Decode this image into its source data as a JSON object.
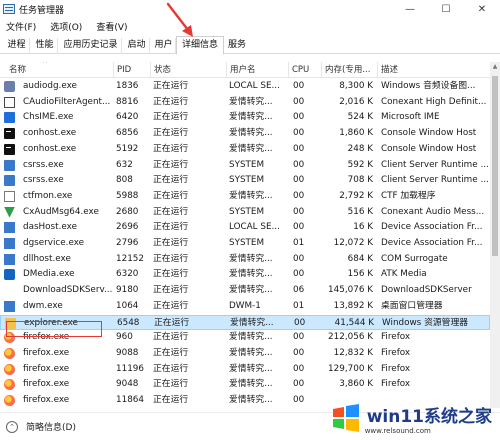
{
  "window": {
    "title": "任务管理器",
    "minimize": "—",
    "maximize": "☐",
    "close": "✕"
  },
  "menu": [
    "文件(F)",
    "选项(O)",
    "查看(V)"
  ],
  "tabs": [
    {
      "label": "进程",
      "active": false
    },
    {
      "label": "性能",
      "active": false
    },
    {
      "label": "应用历史记录",
      "active": false
    },
    {
      "label": "启动",
      "active": false
    },
    {
      "label": "用户",
      "active": false
    },
    {
      "label": "详细信息",
      "active": true
    },
    {
      "label": "服务",
      "active": false
    }
  ],
  "table": {
    "columns": [
      "名称",
      "PID",
      "状态",
      "用户名",
      "CPU",
      "内存(专用...",
      "描述"
    ],
    "sort_indicator": "^",
    "rows": [
      {
        "icon": "gear-icon",
        "name": "audiodg.exe",
        "pid": "1836",
        "status": "正在运行",
        "user": "LOCAL SE...",
        "cpu": "00",
        "mem": "8,300 K",
        "desc": "Windows 音频设备图..."
      },
      {
        "icon": "audio-icon",
        "name": "CAudioFilterAgent...",
        "pid": "8816",
        "status": "正在运行",
        "user": "爱情转究...",
        "cpu": "00",
        "mem": "2,016 K",
        "desc": "Conexant High Definit..."
      },
      {
        "icon": "ime-icon",
        "name": "ChsIME.exe",
        "pid": "6420",
        "status": "正在运行",
        "user": "爱情转究...",
        "cpu": "00",
        "mem": "524 K",
        "desc": "Microsoft IME"
      },
      {
        "icon": "console-icon",
        "name": "conhost.exe",
        "pid": "6856",
        "status": "正在运行",
        "user": "爱情转究...",
        "cpu": "00",
        "mem": "1,860 K",
        "desc": "Console Window Host"
      },
      {
        "icon": "console-icon",
        "name": "conhost.exe",
        "pid": "5192",
        "status": "正在运行",
        "user": "爱情转究...",
        "cpu": "00",
        "mem": "248 K",
        "desc": "Console Window Host"
      },
      {
        "icon": "system-icon",
        "name": "csrss.exe",
        "pid": "632",
        "status": "正在运行",
        "user": "SYSTEM",
        "cpu": "00",
        "mem": "592 K",
        "desc": "Client Server Runtime ..."
      },
      {
        "icon": "system-icon",
        "name": "csrss.exe",
        "pid": "808",
        "status": "正在运行",
        "user": "SYSTEM",
        "cpu": "00",
        "mem": "708 K",
        "desc": "Client Server Runtime ..."
      },
      {
        "icon": "ctf-icon",
        "name": "ctfmon.exe",
        "pid": "5988",
        "status": "正在运行",
        "user": "爱情转究...",
        "cpu": "00",
        "mem": "2,792 K",
        "desc": "CTF 加载程序"
      },
      {
        "icon": "cx-icon",
        "name": "CxAudMsg64.exe",
        "pid": "2680",
        "status": "正在运行",
        "user": "SYSTEM",
        "cpu": "00",
        "mem": "516 K",
        "desc": "Conexant Audio Mess..."
      },
      {
        "icon": "window-icon",
        "name": "dasHost.exe",
        "pid": "2696",
        "status": "正在运行",
        "user": "LOCAL SE...",
        "cpu": "00",
        "mem": "16 K",
        "desc": "Device Association Fr..."
      },
      {
        "icon": "window-icon",
        "name": "dgservice.exe",
        "pid": "2796",
        "status": "正在运行",
        "user": "SYSTEM",
        "cpu": "01",
        "mem": "12,072 K",
        "desc": "Device Association Fr..."
      },
      {
        "icon": "window-icon",
        "name": "dllhost.exe",
        "pid": "12152",
        "status": "正在运行",
        "user": "爱情转究...",
        "cpu": "00",
        "mem": "684 K",
        "desc": "COM Surrogate"
      },
      {
        "icon": "dmedia-icon",
        "name": "DMedia.exe",
        "pid": "6320",
        "status": "正在运行",
        "user": "爱情转究...",
        "cpu": "00",
        "mem": "156 K",
        "desc": "ATK Media"
      },
      {
        "icon": "download-icon",
        "name": "DownloadSDKServ...",
        "pid": "9180",
        "status": "正在运行",
        "user": "爱情转究...",
        "cpu": "06",
        "mem": "145,076 K",
        "desc": "DownloadSDKServer"
      },
      {
        "icon": "window-icon",
        "name": "dwm.exe",
        "pid": "1064",
        "status": "正在运行",
        "user": "DWM-1",
        "cpu": "01",
        "mem": "13,892 K",
        "desc": "桌面窗口管理器"
      },
      {
        "icon": "folder-icon",
        "name": "explorer.exe",
        "pid": "6548",
        "status": "正在运行",
        "user": "爱情转究...",
        "cpu": "00",
        "mem": "41,544 K",
        "desc": "Windows 资源管理器",
        "selected": true
      },
      {
        "icon": "firefox-icon",
        "name": "firefox.exe",
        "pid": "960",
        "status": "正在运行",
        "user": "爱情转究...",
        "cpu": "00",
        "mem": "212,056 K",
        "desc": "Firefox"
      },
      {
        "icon": "firefox-icon",
        "name": "firefox.exe",
        "pid": "9088",
        "status": "正在运行",
        "user": "爱情转究...",
        "cpu": "00",
        "mem": "12,832 K",
        "desc": "Firefox"
      },
      {
        "icon": "firefox-icon",
        "name": "firefox.exe",
        "pid": "11196",
        "status": "正在运行",
        "user": "爱情转究...",
        "cpu": "00",
        "mem": "129,700 K",
        "desc": "Firefox"
      },
      {
        "icon": "firefox-icon",
        "name": "firefox.exe",
        "pid": "9048",
        "status": "正在运行",
        "user": "爱情转究...",
        "cpu": "00",
        "mem": "3,860 K",
        "desc": "Firefox"
      },
      {
        "icon": "firefox-icon",
        "name": "firefox.exe",
        "pid": "11864",
        "status": "正在运行",
        "user": "爱情转究...",
        "cpu": "00",
        "mem": "",
        "desc": ""
      }
    ]
  },
  "footer": {
    "label": "简略信息(D)"
  },
  "watermark": {
    "text": "win11系统之家",
    "sub": "www.relsound.com"
  },
  "colors": {
    "selected_row_bg": "#cce8ff",
    "annotation_red": "#e53935"
  }
}
